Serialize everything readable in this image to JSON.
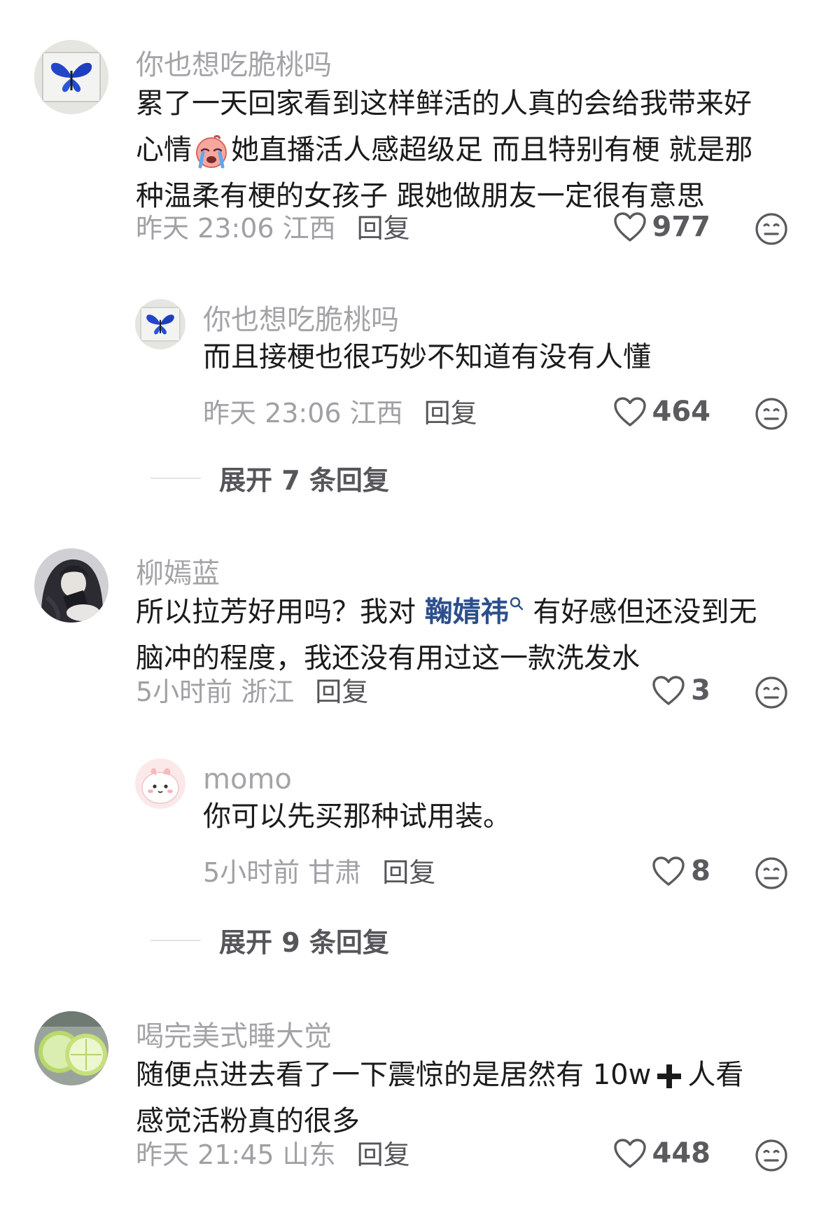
{
  "comments": [
    {
      "username": "你也想吃脆桃吗",
      "avatar_icon": "butterfly-avatar",
      "text_lines": [
        "累了一天回家看到这样鲜活的人真的会给我带来好",
        "她直播活人感超级足 而且特别有梗 就是那",
        "种温柔有梗的女孩子 跟她做朋友一定很有意思"
      ],
      "text_line2_prefix": "心情",
      "time": "昨天 23:06",
      "location": "江西",
      "reply_label": "回复",
      "likes": "977",
      "replies": [
        {
          "username": "你也想吃脆桃吗",
          "avatar_icon": "butterfly-avatar",
          "text": "而且接梗也很巧妙不知道有没有人懂",
          "time": "昨天 23:06",
          "location": "江西",
          "reply_label": "回复",
          "likes": "464"
        }
      ],
      "expand_label": "展开 7 条回复"
    },
    {
      "username": "柳嫣蓝",
      "avatar_icon": "anime-girl-avatar",
      "text_line1_before": "所以拉芳好用吗？我对 ",
      "mention": "鞠婧祎",
      "text_line1_after": " 有好感但还没到无",
      "text_line2": "脑冲的程度，我还没有用过这一款洗发水",
      "time": "5小时前",
      "location": "浙江",
      "reply_label": "回复",
      "likes": "3",
      "replies": [
        {
          "username": "momo",
          "avatar_icon": "pink-bunny-avatar",
          "text": "你可以先买那种试用装。",
          "time": "5小时前",
          "location": "甘肃",
          "reply_label": "回复",
          "likes": "8"
        }
      ],
      "expand_label": "展开 9 条回复"
    },
    {
      "username": "喝完美式睡大觉",
      "avatar_icon": "lime-slice-avatar",
      "text_line1_before": "随便点进去看了一下震惊的是居然有 10w",
      "text_line1_after": "人看",
      "text_line2": "感觉活粉真的很多",
      "time": "昨天 21:45",
      "location": "山东",
      "reply_label": "回复",
      "likes": "448"
    }
  ],
  "colors": {
    "username": "#a4a4a8",
    "text": "#1b1b1b",
    "meta": "#a0a0a5",
    "reply": "#55555a",
    "mention": "#2c4f8c",
    "icon": "#5a5a5f"
  }
}
